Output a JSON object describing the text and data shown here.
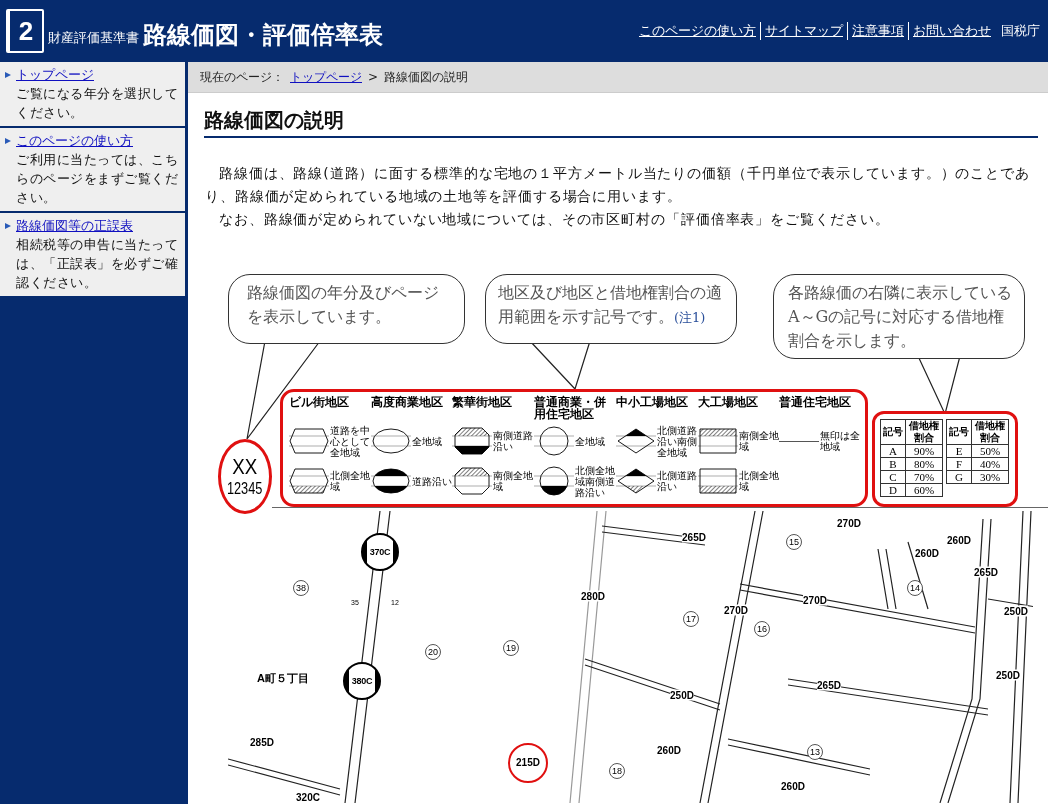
{
  "header": {
    "logo_number": "2",
    "subtitle": "財産評価基準書",
    "title": "路線価図・評価倍率表",
    "links": [
      "このページの使い方",
      "サイトマップ",
      "注意事項",
      "お問い合わせ"
    ],
    "agency": "国税庁"
  },
  "sidebar": {
    "items": [
      {
        "label": "トップページ",
        "description": "ご覧になる年分を選択してください。"
      },
      {
        "label": "このページの使い方",
        "description": "ご利用に当たっては、こちらのページをまずご覧ください。"
      },
      {
        "label": "路線価図等の正誤表",
        "description": "相続税等の申告に当たっては、「正誤表」を必ずご確認ください。"
      }
    ]
  },
  "breadcrumb": {
    "prefix": "現在のページ：",
    "separator": ">",
    "items": [
      {
        "label": "トップページ",
        "kind": "link"
      },
      {
        "label": "路線価図の説明",
        "kind": "current"
      }
    ]
  },
  "page_title": "路線価図の説明",
  "paragraphs": [
    "路線価は、路線(道路）に面する標準的な宅地の１平方メートル当たりの価額（千円単位で表示しています。）のことであり、路線価が定められている地域の土地等を評価する場合に用います。",
    "なお、路線価が定められていない地域については、その市区町村の「評価倍率表」をご覧ください。"
  ],
  "figure": {
    "callouts": [
      {
        "text": "路線価図の年分及びページを表示しています。"
      },
      {
        "text": "地区及び地区と借地権割合の適用範囲を示す記号です。",
        "note_ref": "(注1)"
      },
      {
        "text": "各路線価の右隣に表示しているA～Gの記号に対応する借地権割合を示します。"
      }
    ],
    "page_marker": {
      "code": "XX",
      "number": "12345"
    },
    "legend": [
      {
        "label": "ビル街地区",
        "kind": "hexagon",
        "rows": [
          {
            "note": "道路を中心として全地域",
            "kind": "plain"
          },
          {
            "note": "北側全地域",
            "kind": "hatch-bottom"
          }
        ]
      },
      {
        "label": "高度商業地区",
        "kind": "ellipse",
        "rows": [
          {
            "note": "全地域",
            "kind": "plain"
          },
          {
            "note": "道路沿い",
            "kind": "black-both"
          }
        ]
      },
      {
        "label": "繁華街地区",
        "kind": "octagon",
        "rows": [
          {
            "note": "南側道路沿い",
            "kind": "hatch-top-black-bottom"
          },
          {
            "note": "南側全地域",
            "kind": "hatch-top"
          }
        ]
      },
      {
        "label": "普通商業・併用住宅地区",
        "kind": "circle",
        "rows": [
          {
            "note": "全地域",
            "kind": "plain"
          },
          {
            "note": "北側全地域南側道路沿い",
            "kind": "black-bottom"
          }
        ]
      },
      {
        "label": "中小工場地区",
        "kind": "diamond",
        "rows": [
          {
            "note": "北側道路沿い南側全地域",
            "kind": "black-top"
          },
          {
            "note": "北側道路沿い",
            "kind": "black-top-hatch-bottom"
          }
        ]
      },
      {
        "label": "大工場地区",
        "kind": "rect",
        "rows": [
          {
            "note": "南側全地域",
            "kind": "hatch-top"
          },
          {
            "note": "北側全地域",
            "kind": "hatch-bottom"
          }
        ]
      },
      {
        "label": "普通住宅地区",
        "kind": "line",
        "rows": [
          {
            "note": "無印は全地域"
          }
        ]
      }
    ],
    "ratio_tables": [
      {
        "columns": [
          "記号",
          "借地権割合"
        ],
        "rows": [
          [
            "A",
            "90%"
          ],
          [
            "B",
            "80%"
          ],
          [
            "C",
            "70%"
          ],
          [
            "D",
            "60%"
          ]
        ]
      },
      {
        "columns": [
          "記号",
          "借地権割合"
        ],
        "rows": [
          [
            "E",
            "50%"
          ],
          [
            "F",
            "40%"
          ],
          [
            "G",
            "30%"
          ]
        ]
      }
    ],
    "map_labels": [
      {
        "text": "370C",
        "kind": "marker"
      },
      {
        "text": "38",
        "kind": "block"
      },
      {
        "text": "35",
        "kind": "small"
      },
      {
        "text": "12",
        "kind": "small"
      },
      {
        "text": "20",
        "kind": "block"
      },
      {
        "text": "A町５丁目",
        "kind": "district"
      },
      {
        "text": "380C",
        "kind": "marker"
      },
      {
        "text": "285D",
        "kind": "price"
      },
      {
        "text": "320C",
        "kind": "price"
      },
      {
        "text": "19",
        "kind": "block"
      },
      {
        "text": "280D",
        "kind": "price"
      },
      {
        "text": "265D",
        "kind": "price"
      },
      {
        "text": "215D",
        "kind": "highlight"
      },
      {
        "text": "18",
        "kind": "block"
      },
      {
        "text": "250D",
        "kind": "price"
      },
      {
        "text": "260D",
        "kind": "price"
      },
      {
        "text": "17",
        "kind": "block"
      },
      {
        "text": "270D",
        "kind": "price"
      },
      {
        "text": "16",
        "kind": "block"
      },
      {
        "text": "15",
        "kind": "block"
      },
      {
        "text": "270D",
        "kind": "price"
      },
      {
        "text": "270D",
        "kind": "price"
      },
      {
        "text": "265D",
        "kind": "price"
      },
      {
        "text": "13",
        "kind": "block"
      },
      {
        "text": "260D",
        "kind": "price"
      },
      {
        "text": "14",
        "kind": "block"
      },
      {
        "text": "260D",
        "kind": "price"
      },
      {
        "text": "260D",
        "kind": "price"
      },
      {
        "text": "265D",
        "kind": "price"
      },
      {
        "text": "250D",
        "kind": "price"
      },
      {
        "text": "250D",
        "kind": "price"
      }
    ]
  }
}
